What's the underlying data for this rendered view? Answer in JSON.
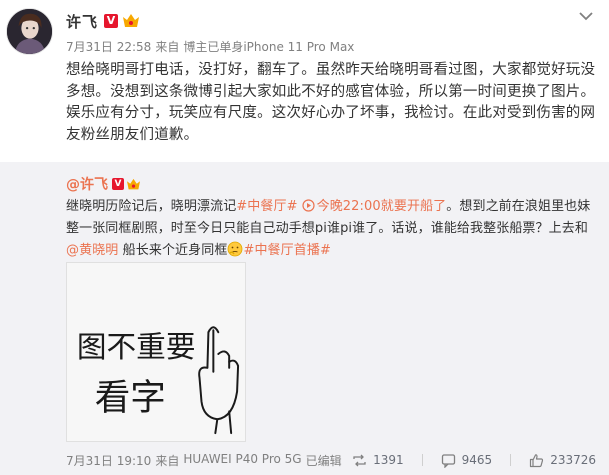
{
  "post": {
    "author": "许飞",
    "verified_badge": "V",
    "time": "7月31日 22:58",
    "source_prefix": "来自",
    "source": "博主已单身iPhone 11 Pro Max",
    "text": "想给晓明哥打电话，没打好，翻车了。虽然昨天给晓明哥看过图，大家都觉好玩没多想。没想到这条微博引起大家如此不好的感官体验，所以第一时间更换了图片。娱乐应有分寸，玩笑应有尺度。这次好心办了坏事，我检讨。在此对受到伤害的网友粉丝朋友们道歉。"
  },
  "repost": {
    "author": "@许飞",
    "verified_badge": "V",
    "text_1": "继晓明历险记后，晓明漂流记",
    "topic_1": "#中餐厅#",
    "live_notice": "今晚22:00就要开船了",
    "text_2": "。想到之前在浪姐里也妹整一张同框剧照，时至今日只能自己动手想pi谁pi谁了。话说，谁能给我整张船票？上去和",
    "mention": "@黄晓明",
    "text_3": " 船长来个近身同框",
    "topic_2": "#中餐厅首播#",
    "image_text_line1": "图不重要",
    "image_text_line2": "看字",
    "time": "7月31日 19:10",
    "source_prefix": "来自",
    "source": "HUAWEI P40 Pro 5G",
    "edited": "已编辑",
    "reposts": "1391",
    "comments": "9465",
    "likes": "233726"
  },
  "icons": {
    "more": "chevron-down-icon",
    "member": "member-crown-icon",
    "repost": "repost-icon",
    "comment": "comment-icon",
    "like": "like-icon",
    "emoji": "thinking-face-icon",
    "live": "play-circle-icon"
  },
  "colors": {
    "link": "#eb7350",
    "badge": "#e6162d",
    "meta": "#808080",
    "repost_bg": "#f2f2f5"
  }
}
